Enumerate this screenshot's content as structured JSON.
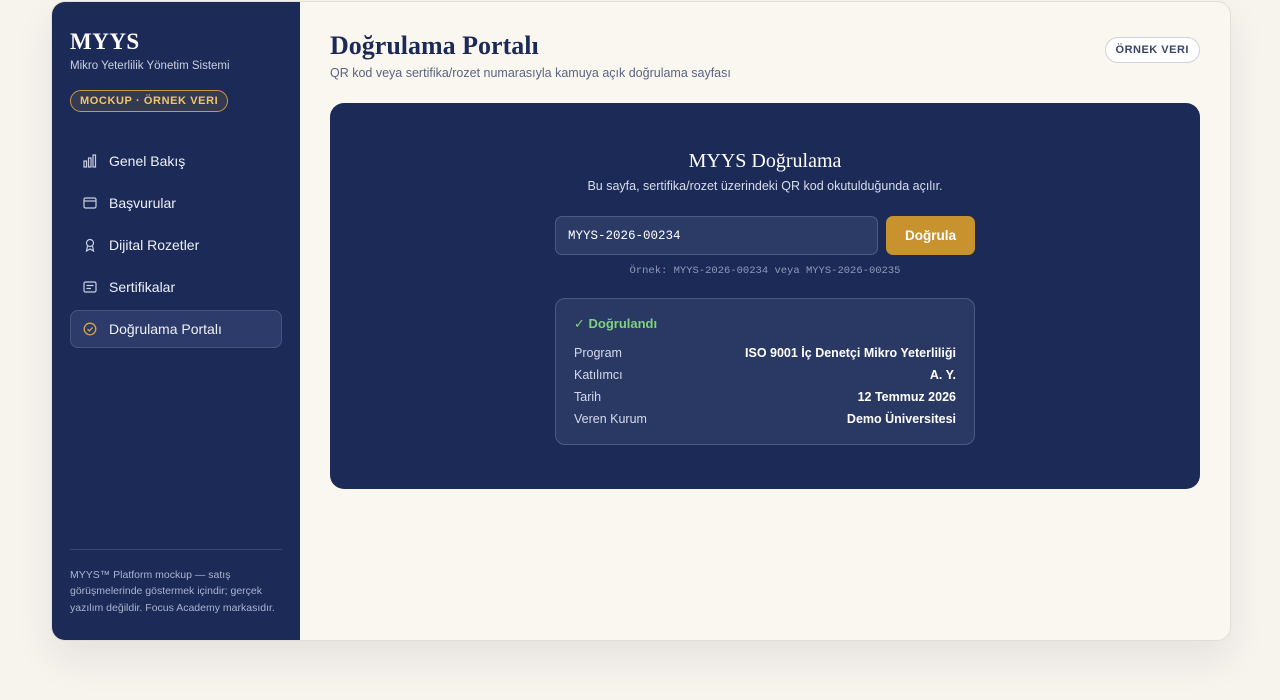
{
  "sidebar": {
    "brand": "MYYS",
    "brand_subtitle": "Mikro Yeterlilik Yönetim Sistemi",
    "mock_badge": "MOCKUP · ÖRNEK VERI",
    "items": [
      {
        "label": "Genel Bakış",
        "icon": "bar-chart-icon"
      },
      {
        "label": "Başvurular",
        "icon": "window-icon"
      },
      {
        "label": "Dijital Rozetler",
        "icon": "award-icon"
      },
      {
        "label": "Sertifikalar",
        "icon": "certificate-icon"
      },
      {
        "label": "Doğrulama Portalı",
        "icon": "check-circle-icon",
        "active": true
      }
    ],
    "footer": "MYYS™ Platform mockup — satış görüşmelerinde göstermek içindir; gerçek yazılım değildir. Focus Academy markasıdır."
  },
  "header": {
    "title": "Doğrulama Portalı",
    "subtitle": "QR kod veya sertifika/rozet numarasıyla kamuya açık doğrulama sayfası",
    "badge": "ÖRNEK VERI"
  },
  "verify": {
    "title": "MYYS Doğrulama",
    "subtitle": "Bu sayfa, sertifika/rozet üzerindeki QR kod okutulduğunda açılır.",
    "input_value": "MYYS-2026-00234",
    "button_label": "Doğrula",
    "hint": "Örnek: MYYS-2026-00234 veya MYYS-2026-00235"
  },
  "result": {
    "status": "✓ Doğrulandı",
    "status_color": "#7fd47a",
    "rows": [
      {
        "label": "Program",
        "value": "ISO 9001 İç Denetçi Mikro Yeterliliği"
      },
      {
        "label": "Katılımcı",
        "value": "A. Y."
      },
      {
        "label": "Tarih",
        "value": "12 Temmuz 2026"
      },
      {
        "label": "Veren Kurum",
        "value": "Demo Üniversitesi"
      }
    ]
  },
  "colors": {
    "sidebar_bg": "#1c2a57",
    "accent": "#c8922e",
    "page_bg": "#faf7f1"
  }
}
